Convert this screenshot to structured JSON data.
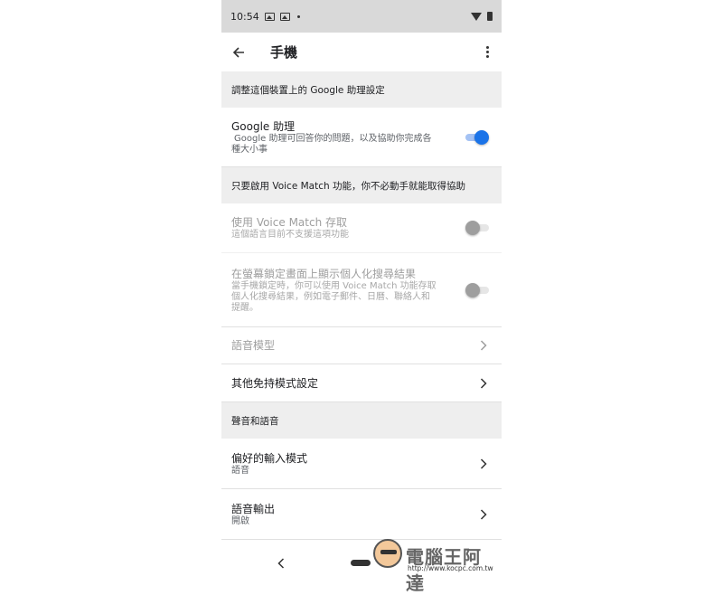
{
  "status_bar": {
    "time": "10:54"
  },
  "app_bar": {
    "title": "手機"
  },
  "sections": {
    "device_header": "調整這個裝置上的 Google 助理設定",
    "voice_match_header": "只要啟用 Voice Match 功能，你不必動手就能取得協助",
    "sound_header": "聲音和語音"
  },
  "items": {
    "google_assistant": {
      "title": "Google 助理",
      "subtitle_line1": "Google 助理可回答你的問題，以及協助你完成各",
      "subtitle_line2": "種大小事",
      "enabled": true
    },
    "voice_match_access": {
      "title": "使用 Voice Match 存取",
      "subtitle": "這個語言目前不支援這項功能",
      "enabled": false
    },
    "lock_screen_results": {
      "title": "在螢幕鎖定畫面上顯示個人化搜尋結果",
      "subtitle_line1": "當手機鎖定時，你可以使用 Voice Match 功能存取",
      "subtitle_line2": "個人化搜尋結果，例如電子郵件、日曆、聯絡人和",
      "subtitle_line3": "提醒。",
      "enabled": false
    },
    "voice_model": {
      "title": "語音模型"
    },
    "hands_free": {
      "title": "其他免持模式設定"
    },
    "preferred_input": {
      "title": "偏好的輸入模式",
      "subtitle": "語音"
    },
    "speech_output": {
      "title": "語音輸出",
      "subtitle": "開啟"
    }
  },
  "watermark": {
    "title": "電腦王阿達",
    "url": "http://www.kocpc.com.tw"
  },
  "colors": {
    "accent": "#1a73e8",
    "header_bg": "#eeeeee",
    "statusbar_bg": "#d9d9d9"
  }
}
